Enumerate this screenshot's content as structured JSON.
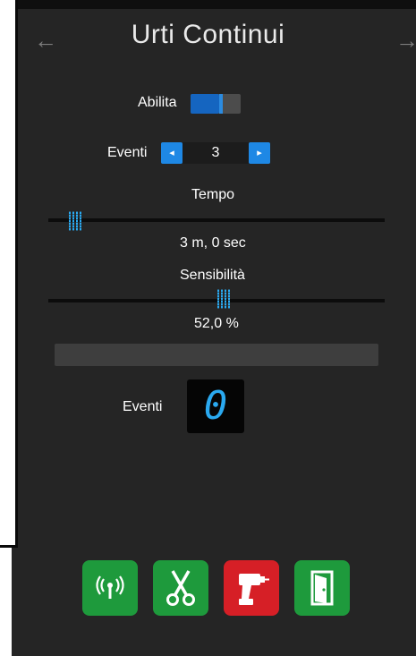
{
  "header": {
    "title": "Urti Continui",
    "back_arrow": "←",
    "forward_arrow": "→"
  },
  "enable": {
    "label": "Abilita",
    "value": true
  },
  "events_stepper": {
    "label": "Eventi",
    "minus_glyph": "◂",
    "plus_glyph": "▸",
    "value": "3"
  },
  "time": {
    "label": "Tempo",
    "value_text": "3 m, 0 sec",
    "slider_fraction": 0.08
  },
  "sensitivity": {
    "label": "Sensibilità",
    "value_text": "52,0 %",
    "slider_fraction": 0.52
  },
  "progress": {
    "fraction": 0
  },
  "events_counter": {
    "label": "Eventi",
    "value": "0"
  },
  "actions": [
    {
      "name": "radio-icon",
      "color": "#1e9a3c"
    },
    {
      "name": "scissors-icon",
      "color": "#1e9a3c"
    },
    {
      "name": "drill-icon",
      "color": "#d61f26"
    },
    {
      "name": "door-icon",
      "color": "#1e9a3c"
    }
  ],
  "colors": {
    "panel_bg": "#252525",
    "accent": "#1e88e5",
    "digit": "#2aa9f0"
  }
}
